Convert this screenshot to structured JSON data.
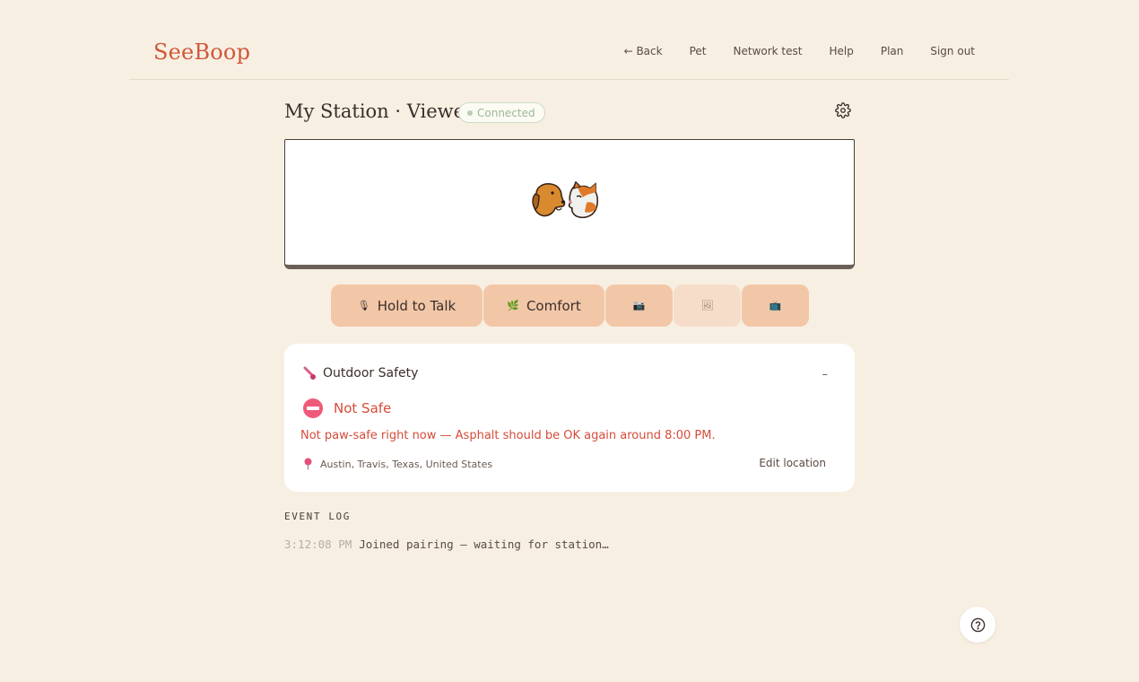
{
  "brand": {
    "logo": "SeeBoop",
    "accent": "#d0583a"
  },
  "nav": {
    "items": [
      {
        "label": "← Back"
      },
      {
        "label": "Pet"
      },
      {
        "label": "Network test"
      },
      {
        "label": "Help"
      },
      {
        "label": "Plan"
      },
      {
        "label": "Sign out"
      }
    ]
  },
  "station": {
    "title": "My Station · Viewer",
    "status": "Connected",
    "status_color": "#9bb89a",
    "settings_icon": "gear-icon"
  },
  "video": {
    "placeholder_icon": "dog-cat-icon"
  },
  "controls": {
    "talk": {
      "icon": "microphone-icon",
      "glyph": "🎙",
      "label": "Hold to Talk"
    },
    "comfort": {
      "icon": "leaf-icon",
      "glyph": "🌿",
      "label": "Comfort"
    },
    "camera": {
      "icon": "camera-icon",
      "glyph": "📷"
    },
    "snapshot": {
      "icon": "photo-icon",
      "glyph": "🖼"
    },
    "display": {
      "icon": "tv-icon",
      "glyph": "📺"
    }
  },
  "safety": {
    "title": "Outdoor Safety",
    "title_icon": "thermometer-icon",
    "collapse_glyph": "–",
    "status": "Not Safe",
    "status_color": "#d64b3a",
    "message": "Not paw-safe right now — Asphalt should be OK again around 8:00 PM.",
    "location": "Austin, Travis, Texas, United States",
    "edit_label": "Edit location"
  },
  "event_log": {
    "heading": "EVENT LOG",
    "entries": [
      {
        "time": "3:12:08 PM",
        "message": "Joined pairing — waiting for station…"
      }
    ]
  },
  "help_fab": {
    "icon": "question-icon"
  }
}
